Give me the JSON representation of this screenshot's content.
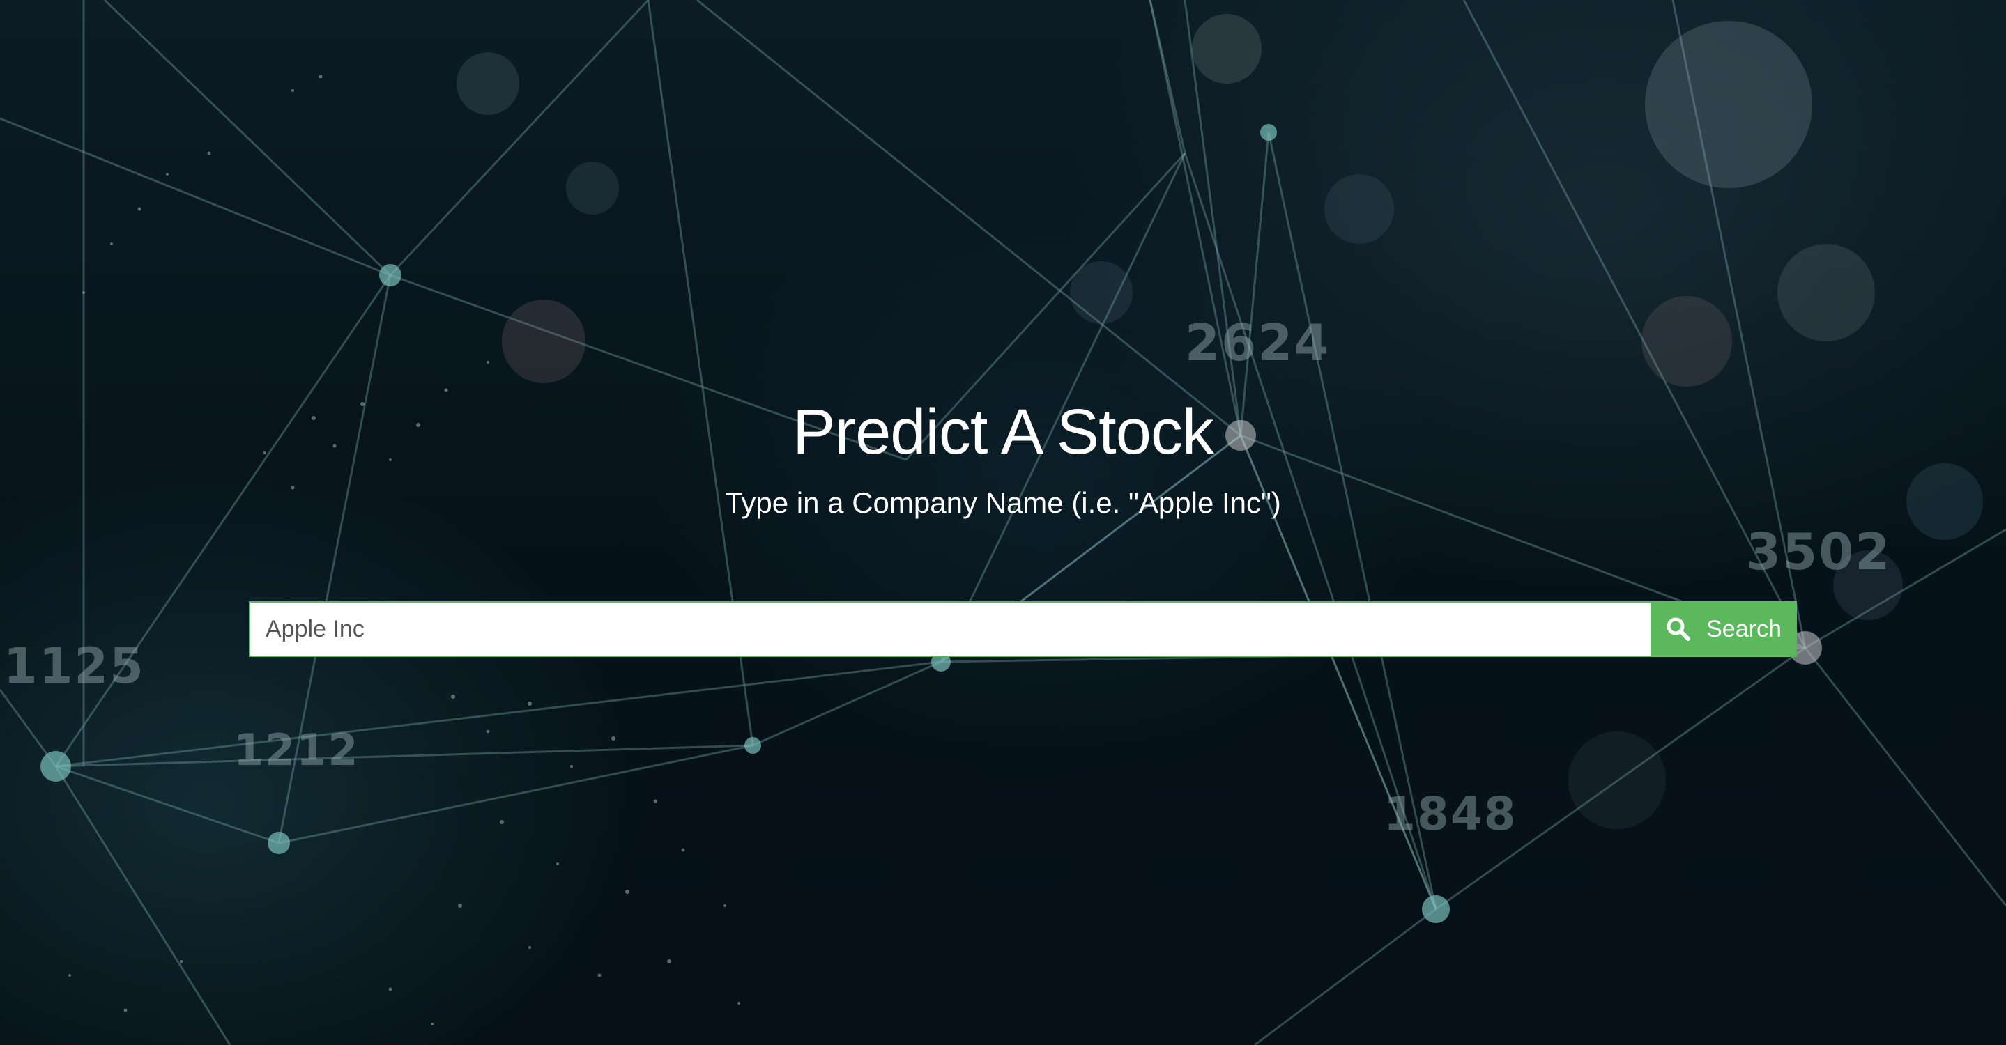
{
  "hero": {
    "title": "Predict A Stock",
    "subtitle": "Type in a Company Name (i.e. \"Apple Inc\")"
  },
  "search": {
    "value": "Apple Inc",
    "button_label": "Search",
    "button_icon": "search-icon"
  },
  "background": {
    "numbers": [
      "2624",
      "3502",
      "1125",
      "1212",
      "1848"
    ]
  },
  "colors": {
    "accent": "#5cb85c",
    "text": "#ffffff"
  }
}
